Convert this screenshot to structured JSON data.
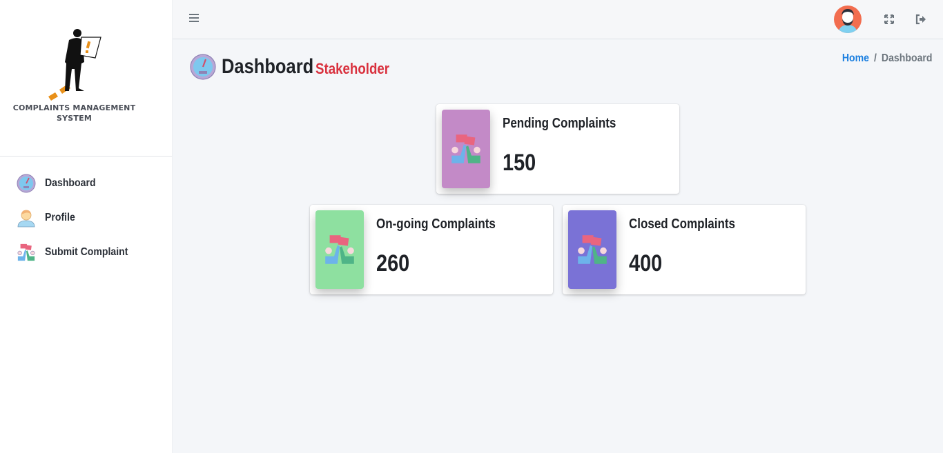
{
  "app": {
    "name_line1": "COMPLAINTS MANAGEMENT",
    "name_line2": "SYSTEM"
  },
  "sidebar": {
    "items": [
      {
        "label": "Dashboard",
        "icon": "speedometer-icon"
      },
      {
        "label": "Profile",
        "icon": "user-icon"
      },
      {
        "label": "Submit Complaint",
        "icon": "complaint-icon"
      }
    ]
  },
  "topbar": {
    "menu_icon": "hamburger-icon",
    "avatar_icon": "user-avatar",
    "fullscreen_icon": "expand-icon",
    "logout_icon": "sign-out-icon"
  },
  "header": {
    "title": "Dashboard",
    "subtitle": "Stakeholder"
  },
  "breadcrumb": {
    "home": "Home",
    "separator": "/",
    "current": "Dashboard"
  },
  "cards": [
    {
      "title": "Pending Complaints",
      "value": "150",
      "color": "#c38ac7"
    },
    {
      "title": "On-going Complaints",
      "value": "260",
      "color": "#8ee0a0"
    },
    {
      "title": "Closed Complaints",
      "value": "400",
      "color": "#7a72d6"
    }
  ],
  "colors": {
    "accent_red": "#d9313e",
    "link_blue": "#1b7fe0",
    "logo_orange": "#e8901a"
  }
}
